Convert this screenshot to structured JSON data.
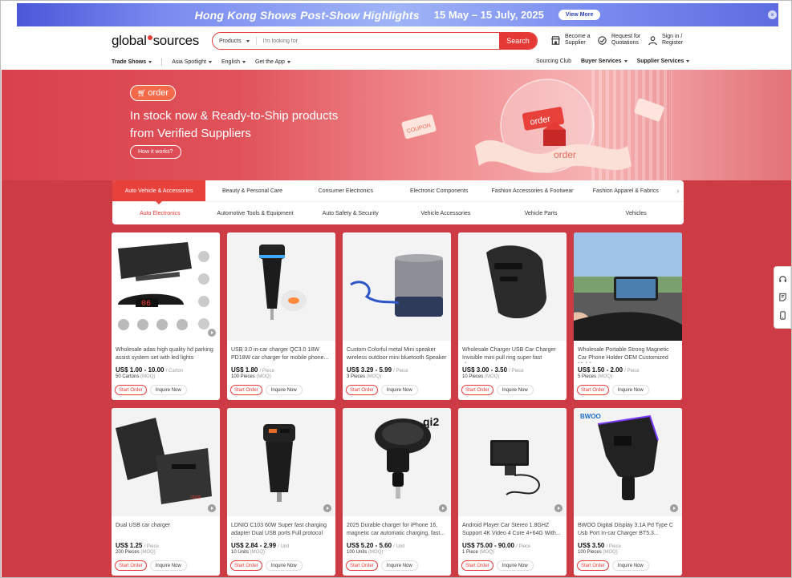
{
  "promo": {
    "title": "Hong Kong Shows Post-Show Highlights",
    "dates": "15 May – 15 July, 2025",
    "button": "View More",
    "close": "×"
  },
  "header": {
    "logo_left": "global",
    "logo_right": "sources",
    "search_category": "Products",
    "search_placeholder": "I'm looking for",
    "search_button": "Search",
    "actions": [
      {
        "line1": "Become a",
        "line2": "Supplier",
        "icon": "store-icon"
      },
      {
        "line1": "Request for",
        "line2": "Quotations",
        "icon": "rfq-icon"
      },
      {
        "line1": "Sign in /",
        "line2": "Register",
        "icon": "user-icon"
      }
    ]
  },
  "subnav": {
    "left": [
      "Trade Shows",
      "Asia Spotlight",
      "English",
      "Get the App"
    ],
    "right": [
      "Sourcing Club",
      "Buyer Services",
      "Supplier Services"
    ]
  },
  "hero": {
    "badge": "order",
    "headline_line1": "In stock now & Ready-to-Ship products",
    "headline_line2": "from Verified Suppliers",
    "button": "How it works?",
    "art_label": "order",
    "coupon": "COUPON"
  },
  "categories": {
    "tabs": [
      "Auto Vehicle & Accessories",
      "Beauty & Personal Care",
      "Consumer Electronics",
      "Electronic Components",
      "Fashion Accessories & Footwear",
      "Fashion Apparel & Fabrics"
    ],
    "subtabs": [
      "Auto Electronics",
      "Automotive Tools & Equipment",
      "Auto Safety & Security",
      "Vehicle Accessories",
      "Vehicle Parts",
      "Vehicles"
    ]
  },
  "buttons": {
    "start_order": "Start Order",
    "inquire": "Inquire Now",
    "moq": "(MOQ)"
  },
  "products": [
    {
      "title": "Wholesale adas high quality hd parking assist system set with led lights",
      "price": "US$ 1.00 - 10.00",
      "unit": "/ Carton",
      "moq": "50 Cartons"
    },
    {
      "title": "USB 3.0 in-car charger QC3.0 18W PD18W car charger for mobile phone...",
      "price": "US$ 1.80",
      "unit": "/ Piece",
      "moq": "100 Pieces"
    },
    {
      "title": "Custom Colorful metal Mini speaker wireless outdoor mini bluetooth Speaker",
      "price": "US$ 3.29 - 5.99",
      "unit": "/ Piece",
      "moq": "3 Pieces"
    },
    {
      "title": "Wholesale Charger USB Car Charger Invisible mini pull ring super fast charge...",
      "price": "US$ 3.00 - 3.50",
      "unit": "/ Piece",
      "moq": "10 Pieces"
    },
    {
      "title": "Wholesale Portable Strong Magnetic Car Phone Holder OEM Customized Mobile...",
      "price": "US$ 1.50 - 2.00",
      "unit": "/ Piece",
      "moq": "5 Pieces"
    },
    {
      "title": "Dual USB car charger",
      "price": "US$ 1.25",
      "unit": "/ Piece",
      "moq": "200 Pieces"
    },
    {
      "title": "LDNIO C103 60W Super fast charging adapter Dual USB ports Full protocol in...",
      "price": "US$ 2.84 - 2.99",
      "unit": "/ Unit",
      "moq": "10 Units"
    },
    {
      "title": "2025 Durable charger for iPhone 16, magnetic car automatic charging, fast...",
      "price": "US$ 5.20 - 5.60",
      "unit": "/ Unit",
      "moq": "100 Units"
    },
    {
      "title": "Android Player Car Stereo 1.8GHZ Support 4K Video 4 Core 4+64G With...",
      "price": "US$ 75.00 - 90.00",
      "unit": "/ Piece",
      "moq": "1 Piece"
    },
    {
      "title": "BWOO Digital Display 3.1A Pd Type C Usb Port In-car Charger BT5.3...",
      "price": "US$ 3.50",
      "unit": "/ Piece",
      "moq": "100 Pieces"
    }
  ],
  "image_text": {
    "display_digits": "06",
    "qi2": "qi2",
    "bwoo": "BWOO",
    "model": "7533F"
  },
  "colors": {
    "brand_red": "#e53935",
    "page_bg": "#cd3b45"
  }
}
